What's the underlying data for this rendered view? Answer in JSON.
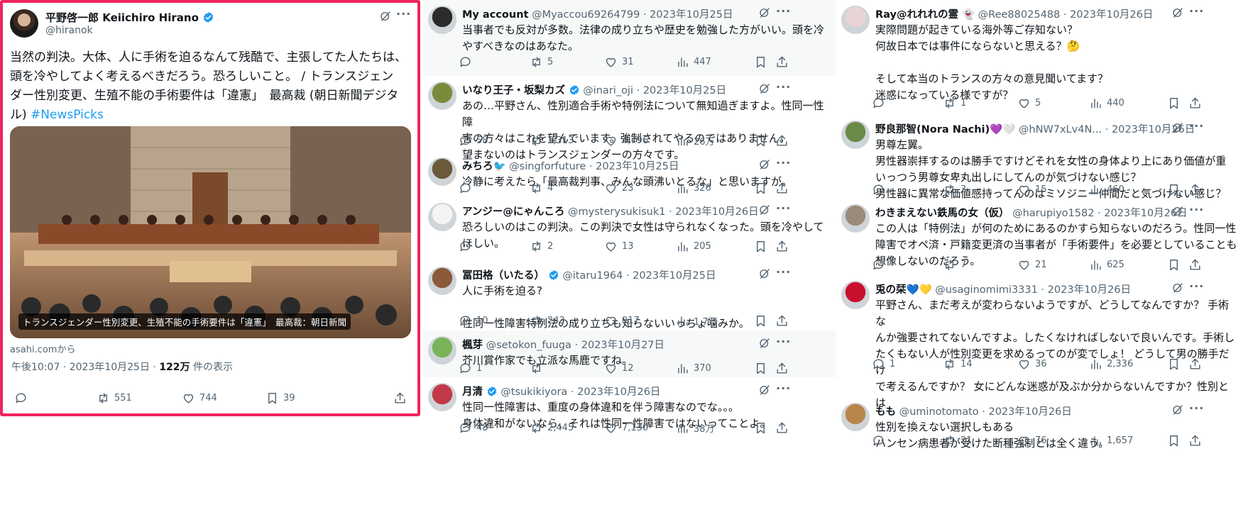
{
  "main_tweet": {
    "name": "平野啓一郎 Keiichiro Hirano",
    "handle": "@hiranok",
    "text_line1": "当然の判決。大体、人に手術を迫るなんて残酷で、主張してた人たちは、",
    "text_line2": "頭を冷やしてよく考えるべきだろう。恐ろしいこと。 / トランスジェン",
    "text_line3": "ダー性別変更、生殖不能の手術要件は「違憲」　最高裁 (朝日新聞デジタ",
    "text_line4_prefix": "ル) ",
    "hashtag": "#NewsPicks",
    "image_caption": "トランスジェンダー性別変更、生殖不能の手術要件は「違憲」　最高裁：朝日新聞",
    "source": "asahi.comから",
    "time": "午後10:07 · 2023年10月25日 · ",
    "views": "122万",
    "views_suffix": " 件の表示",
    "replies": "",
    "retweets": "551",
    "likes": "744",
    "bookmarks": "39"
  },
  "replies_col2": [
    {
      "name": "My account",
      "handle": "@Myaccou69264799 · 2023年10月25日",
      "verified": false,
      "text": "当事者でも反対が多数。法律の成り立ちや歴史を勉強した方がいい。頭を冷\nやすべきなのはあなた。",
      "replies": "",
      "retweets": "5",
      "likes": "31",
      "views": "447"
    },
    {
      "name": "いなり王子・坂梨カズ",
      "handle": "@inari_oji · 2023年10月25日",
      "verified": true,
      "text": "あの…平野さん、性別適合手術や特例法について無知過ぎますよ。性同一性障\n害の方々はこれを望んでいます。強制されてやるのではありません。\n望まないのはトランスジェンダーの方々です。",
      "replies": "58",
      "retweets": "1,313",
      "likes": "4,796",
      "views": "26万"
    },
    {
      "name": "みちろ🐦",
      "handle": "@singforfuture · 2023年10月25日",
      "verified": false,
      "text": "冷静に考えたら「最高裁判事、みんな頭沸いとるな」と思いますが。",
      "replies": "",
      "retweets": "4",
      "likes": "23",
      "views": "326"
    },
    {
      "name": "アンジー@にゃんころ",
      "handle": "@mysterysukisuk1 · 2023年10月26日",
      "verified": false,
      "text": "恐ろしいのはこの判決。この判決で女性は守られなくなった。頭を冷やして\nほしい。",
      "replies": "",
      "retweets": "2",
      "likes": "13",
      "views": "205"
    },
    {
      "name": "冨田格（いたる）",
      "handle": "@itaru1964 · 2023年10月25日",
      "verified": true,
      "text": "人に手術を迫る?\n\n性同一性障害特例法の成り立ちも知らないいっちょ噛みか。",
      "replies": "10",
      "retweets": "243",
      "likes": "917",
      "views": "1.7万"
    },
    {
      "name": "楓芽",
      "handle": "@setokon_fuuga · 2023年10月27日",
      "verified": false,
      "text": "芥川賞作家でも立派な馬鹿ですね。",
      "replies": "1",
      "retweets": "",
      "likes": "12",
      "views": "370"
    },
    {
      "name": "月清",
      "handle": "@tsukikiyora · 2023年10月26日",
      "verified": true,
      "text": "性同一性障害は、重度の身体違和を伴う障害なのでな。。。\n身体違和がないなら、それは性同一性障害ではないってことよ。",
      "replies": "48",
      "retweets": "2,445",
      "likes": "7,130",
      "views": "38万"
    }
  ],
  "replies_col3": [
    {
      "name": "Ray@れれれの霊 👻",
      "handle": "@Ree88025488 · 2023年10月26日",
      "verified": false,
      "text": "実際問題が起きている海外等ご存知ない？\n何故日本では事件にならないと思える？🤔\n\nそして本当のトランスの方々の意見聞いてます？\n迷惑になっている様ですが？",
      "replies": "",
      "retweets": "1",
      "likes": "5",
      "views": "440"
    },
    {
      "name": "野良那智(Nora Nachi)💜🤍",
      "handle": "@hNW7xLv4N...  · 2023年10月26日",
      "verified": false,
      "text": "男尊左翼。\n男性器崇拝するのは勝手ですけどそれを女性の身体より上にあり価値が重\nいっつう男尊女卑丸出しにしてんのが気づけない感じ？\n男性器に異常な価値感持ってんのはミソジニー仲間だと気づけない感じ？",
      "replies": "",
      "retweets": "3",
      "likes": "15",
      "views": "460"
    },
    {
      "name": "わきまえない鉄馬の女（仮）",
      "handle": "@harupiyo1582 · 2023年10月26日",
      "verified": false,
      "text": "この人は「特例法」が何のためにあるのかすら知らないのだろう。性同一性\n障害でオペ済・戸籍変更済の当事者が「手術要件」を必要としていることも\n想像しないのだろう。",
      "replies": "",
      "retweets": "7",
      "likes": "21",
      "views": "625"
    },
    {
      "name": "兎の栞💙💛",
      "handle": "@usaginomimi3331 · 2023年10月26日",
      "verified": false,
      "text": "平野さん、まだ考えが変わらないようですが、どうしてなんですか？ 手術な\nんか強要されてないんですよ。したくなければしないで良いんです。手術し\nたくもない人が性別変更を求めるってのが変でしょ！ どうして男の勝手だけ\nで考えるんですか？ 女にどんな迷惑が及ぶか分からないんですか？性別とは",
      "replies": "1",
      "retweets": "14",
      "likes": "36",
      "views": "2,336"
    },
    {
      "name": "もも",
      "handle": "@uminotomato · 2023年10月26日",
      "verified": false,
      "text": "性別を換えない選択しもある\nハンセン病患者が受けた断種強制とは全く違う。",
      "replies": "",
      "retweets": "21",
      "likes": "76",
      "views": "1,657"
    }
  ]
}
